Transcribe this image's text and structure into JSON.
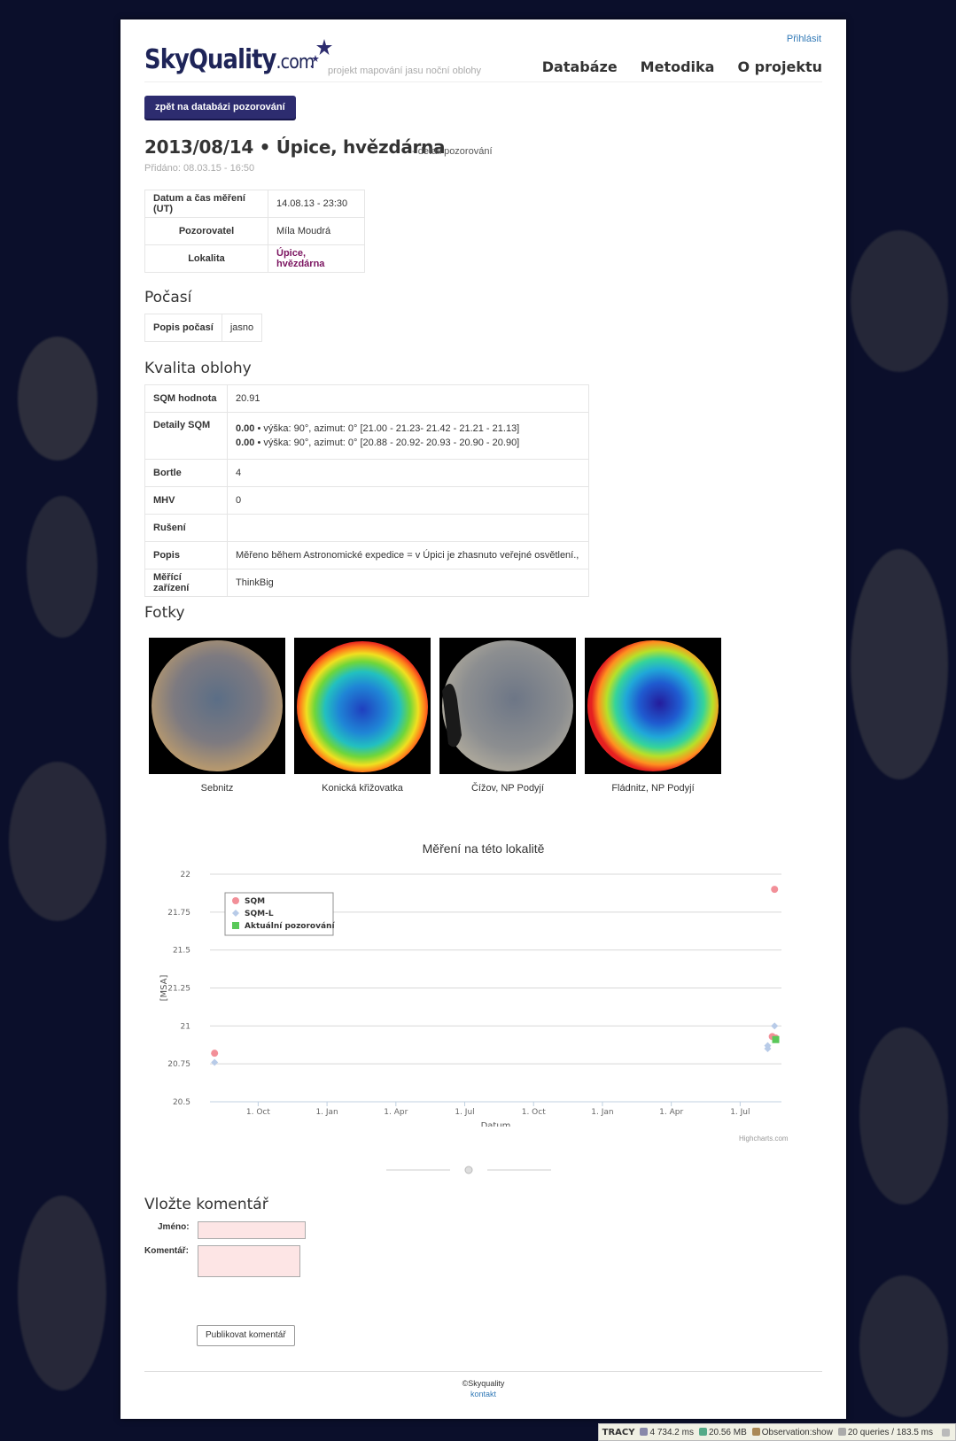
{
  "header": {
    "login_label": "Přihlásit",
    "logo_text": "SkyQuality",
    "logo_suffix": ".com",
    "tagline": "projekt mapování jasu noční oblohy",
    "nav": [
      "Databáze",
      "Metodika",
      "O projektu"
    ]
  },
  "back_button": "zpět na databázi pozorování",
  "title": "2013/08/14 • Úpice, hvězdárna",
  "subtitle": "- detail pozorování",
  "added": "Přidáno: 08.03.15 - 16:50",
  "info": {
    "rows": [
      {
        "key": "Datum a čas měření (UT)",
        "value": "14.08.13 - 23:30"
      },
      {
        "key": "Pozorovatel",
        "value": "Míla Moudrá"
      },
      {
        "key": "Lokalita",
        "value": "Úpice, hvězdárna"
      }
    ]
  },
  "weather": {
    "heading": "Počasí",
    "key": "Popis počasí",
    "value": "jasno"
  },
  "sky": {
    "heading": "Kvalita oblohy",
    "sqm_key": "SQM hodnota",
    "sqm_value": "20.91",
    "details_key": "Detaily SQM",
    "details": [
      {
        "bold": "0.00",
        "text": " • výška: 90°, azimut: 0° [21.00 - 21.23- 21.42 - 21.21 - 21.13]"
      },
      {
        "bold": "0.00",
        "text": " • výška: 90°, azimut: 0° [20.88 - 20.92- 20.93 - 20.90 - 20.90]"
      }
    ],
    "bortle_key": "Bortle",
    "bortle_value": "4",
    "mhv_key": "MHV",
    "mhv_value": "0",
    "ruseni_key": "Rušení",
    "ruseni_value": "",
    "popis_key": "Popis",
    "popis_value": "Měřeno během Astronomické expedice = v Úpici je zhasnuto veřejné osvětlení.,",
    "device_key": "Měřící zařízení",
    "device_value": "ThinkBig"
  },
  "photos": {
    "heading": "Fotky",
    "items": [
      {
        "caption": "Sebnitz",
        "style": "natural-warm"
      },
      {
        "caption": "Konická křižovatka",
        "style": "false-color"
      },
      {
        "caption": "Čížov, NP Podyjí",
        "style": "natural-grey"
      },
      {
        "caption": "Fládnitz, NP Podyjí",
        "style": "false-color"
      }
    ]
  },
  "chart_data": {
    "type": "scatter",
    "title": "Měření na této lokalitě",
    "xlabel": "Datum",
    "ylabel": "[MSA]",
    "ylim": [
      20.5,
      22
    ],
    "yticks": [
      "22",
      "21.75",
      "21.5",
      "21.25",
      "21",
      "20.75",
      "20.5"
    ],
    "xticks": [
      "1. Oct",
      "1. Jan",
      "1. Apr",
      "1. Jul",
      "1. Oct",
      "1. Jan",
      "1. Apr",
      "1. Jul"
    ],
    "xtick_values": [
      0,
      3,
      6,
      9,
      12,
      15,
      18,
      21
    ],
    "xlim": [
      -2.1,
      22.8
    ],
    "grid": true,
    "legend_position": "top-left",
    "credits": "Highcharts.com",
    "series": [
      {
        "name": "SQM",
        "color": "#f28f98",
        "marker": "circle",
        "points": [
          [
            -1.9,
            20.82
          ],
          [
            22.5,
            21.9
          ],
          [
            22.4,
            20.93
          ],
          [
            22.55,
            20.92
          ]
        ]
      },
      {
        "name": "SQM-L",
        "color": "#b8cbe8",
        "marker": "diamond",
        "points": [
          [
            -1.9,
            20.76
          ],
          [
            22.5,
            21.0
          ],
          [
            22.2,
            20.85
          ],
          [
            22.2,
            20.87
          ]
        ]
      },
      {
        "name": "Aktuální pozorování",
        "color": "#5ac85a",
        "marker": "square",
        "points": [
          [
            22.55,
            20.91
          ]
        ]
      }
    ]
  },
  "comment_form": {
    "heading": "Vložte komentář",
    "name_label": "Jméno:",
    "comment_label": "Komentář:",
    "submit_label": "Publikovat komentář"
  },
  "footer": {
    "copyright": "©Skyquality",
    "contact": "kontakt"
  },
  "tracy_bar": {
    "label": "TRACY",
    "time": "4 734.2 ms",
    "memory": "20.56 MB",
    "observation": "Observation:show",
    "queries": "20 queries / 183.5 ms"
  }
}
